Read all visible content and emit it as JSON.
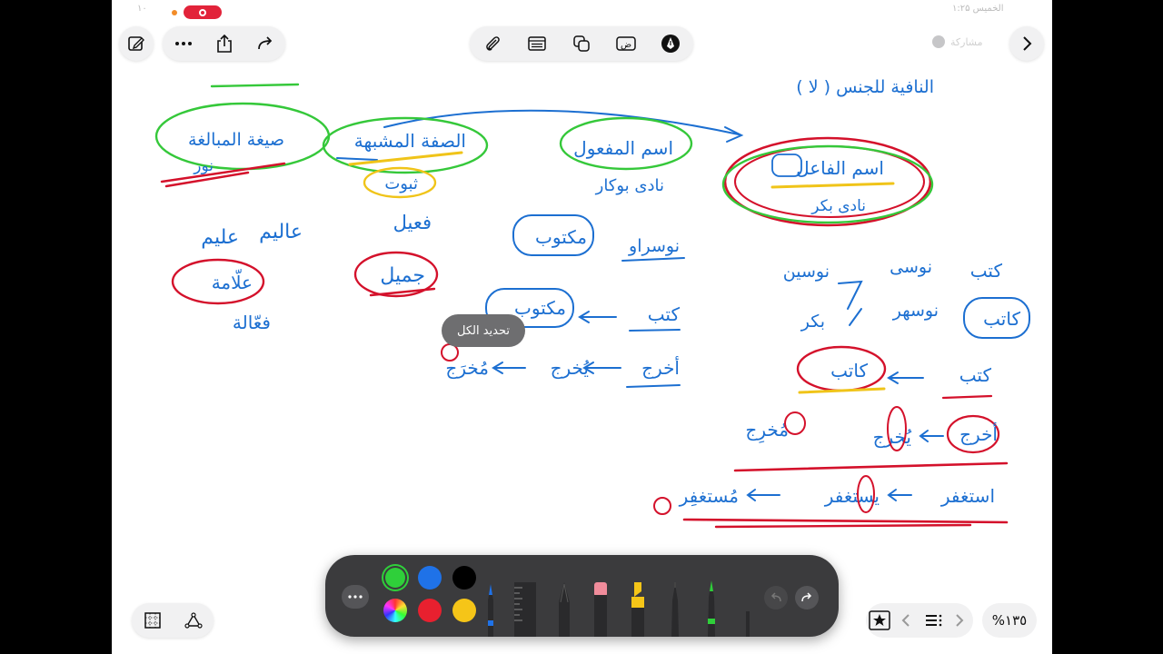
{
  "status_bar": {
    "left_text": "۱۰",
    "right_text": "الخميس ۱:۲۵"
  },
  "top_left_toolbar": {
    "icons": [
      "compose-icon",
      "more-icon",
      "share-icon",
      "redo-icon"
    ]
  },
  "top_center_toolbar": {
    "icons": [
      "paperclip-icon",
      "table-icon",
      "copy-icon",
      "text-box-icon",
      "pen-circle-icon"
    ]
  },
  "top_right": {
    "collaborator_label": "مشاركة",
    "forward_icon": "chevron-right-icon"
  },
  "tooltip": {
    "label": "تحديد الكل"
  },
  "notes": {
    "header": "( لا ) النافية للجنس",
    "categories": [
      {
        "title": "اسم الفاعل",
        "subtitle": "نادى بكر"
      },
      {
        "title": "اسم المفعول",
        "subtitle": "نادى بوكار"
      },
      {
        "title": "الصفة المشبهة",
        "subtitle": "ثبوت"
      },
      {
        "title": "صيغة المبالغة",
        "subtitle": "نور"
      }
    ],
    "col_mubalagha": [
      "عليم",
      "عاليم",
      "علّامة",
      "فعّالة"
    ],
    "col_mushabbaha": [
      "فعيل",
      "جميل"
    ],
    "col_mafool": [
      "مكتوب",
      "نوسراو",
      "كتب",
      "مكتوب",
      "أخرج",
      "يُخرج",
      "مُخرَج"
    ],
    "col_fael": [
      "كتب",
      "نوسى",
      "نوسين",
      "كاتب",
      "نوسهر",
      "بكر",
      "كتب",
      "كاتب",
      "أخرج",
      "يُخرج",
      "مُخرِج",
      "استغفر",
      "يستغفر",
      "مُستغفِر"
    ]
  },
  "markup_toolbar": {
    "more_icon": "more-icon",
    "colors": [
      "#2fcf3a",
      "#1f72e8",
      "#000000",
      "multicolor",
      "#e8202f",
      "#f5c518"
    ],
    "selected_color": "#2fcf3a",
    "tools": [
      "pen",
      "ruler",
      "pencil",
      "eraser",
      "highlighter",
      "fineliner",
      "marker",
      "lasso"
    ],
    "undo_icon": "undo-icon",
    "redo_icon": "redo-icon"
  },
  "bottom_left": {
    "icons": [
      "grid-icon",
      "shapes-icon"
    ]
  },
  "page_nav": {
    "icons": [
      "star-icon",
      "chevron-left-icon",
      "list-icon",
      "chevron-right-icon"
    ]
  },
  "zoom": {
    "label": "%١٣٥"
  },
  "colors": {
    "ink_blue": "#1c6fd1",
    "ink_green": "#35c83a",
    "ink_red": "#d4112b",
    "ink_yellow": "#f0c419"
  }
}
